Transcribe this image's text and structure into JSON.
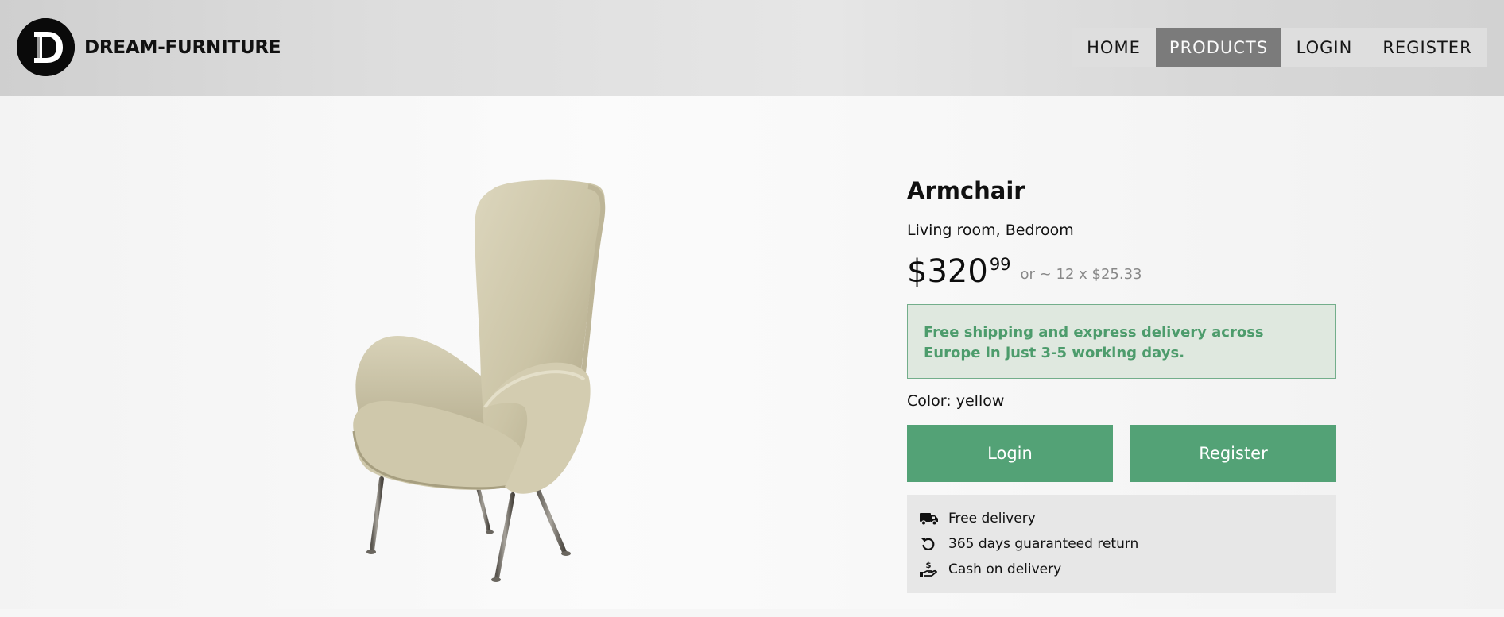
{
  "brand": {
    "name": "DREAM-FURNITURE",
    "logo_letter": "D",
    "logo_icon": "d-monogram-logo"
  },
  "nav": {
    "items": [
      {
        "label": "HOME",
        "active": false
      },
      {
        "label": "PRODUCTS",
        "active": true
      },
      {
        "label": "LOGIN",
        "active": false
      },
      {
        "label": "REGISTER",
        "active": false
      }
    ]
  },
  "product": {
    "title": "Armchair",
    "categories": "Living room, Bedroom",
    "price_currency": "$",
    "price_whole": "320",
    "price_cents": "99",
    "installment": "or ~ 12 x $25.33",
    "shipping_notice": "Free shipping and express delivery across Europe in just 3-5 working days.",
    "color_label": "Color:",
    "color_value": "yellow",
    "image_icon": "armchair-image"
  },
  "actions": {
    "login_label": "Login",
    "register_label": "Register"
  },
  "features": [
    {
      "icon": "truck-icon",
      "label": "Free delivery"
    },
    {
      "icon": "undo-icon",
      "label": "365 days guaranteed return"
    },
    {
      "icon": "cash-hand-icon",
      "label": "Cash on delivery"
    }
  ],
  "colors": {
    "accent_green": "#53a276",
    "notice_bg": "#dfe8df",
    "notice_text": "#4d9c6c",
    "nav_active_bg": "#7b7b7b"
  }
}
